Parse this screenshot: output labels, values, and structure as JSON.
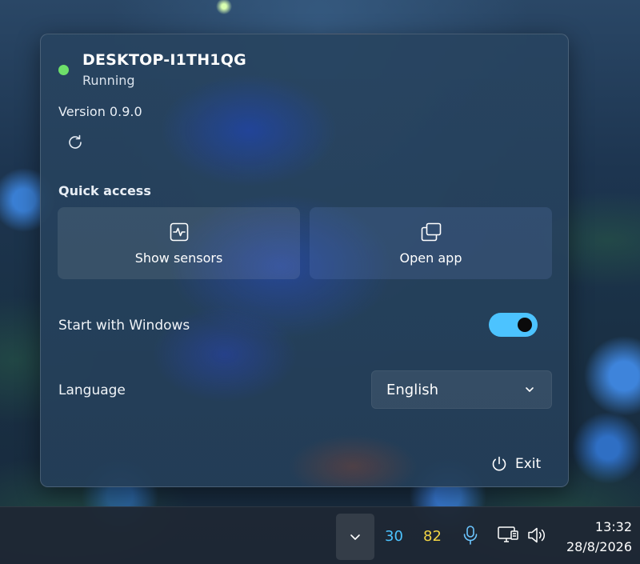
{
  "device": {
    "name": "DESKTOP-I1TH1QG",
    "status": "Running",
    "status_color": "#6ee06a",
    "version": "Version 0.9.0"
  },
  "quick_access": {
    "label": "Quick access",
    "tiles": [
      {
        "label": "Show sensors",
        "icon": "activity-icon"
      },
      {
        "label": "Open app",
        "icon": "windows-stack-icon"
      }
    ]
  },
  "settings": {
    "start_with_windows": {
      "label": "Start with Windows",
      "enabled": true,
      "accent": "#4cc3ff"
    },
    "language": {
      "label": "Language",
      "selected": "English"
    }
  },
  "exit_label": "Exit",
  "taskbar": {
    "tray_values": [
      {
        "value": "30",
        "color": "#4cc3ff"
      },
      {
        "value": "82",
        "color": "#f2d544"
      }
    ],
    "time": "13:32",
    "date": "28/8/2026"
  }
}
